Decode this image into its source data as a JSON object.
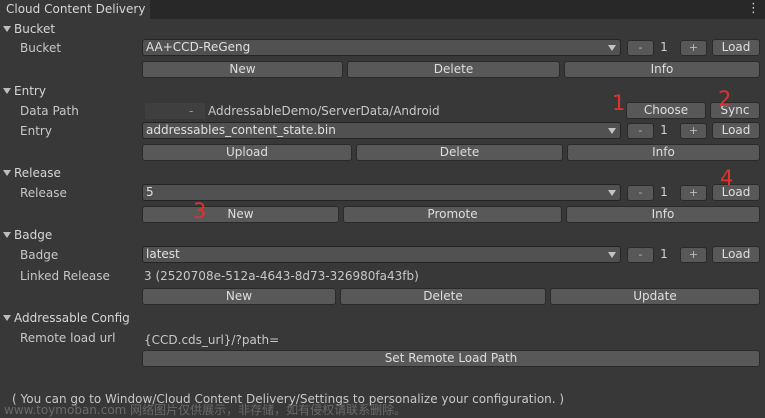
{
  "window": {
    "tab_title": "Cloud Content Delivery",
    "menu_icon": "kebab-menu-icon"
  },
  "bucket": {
    "section": "Bucket",
    "label": "Bucket",
    "selected": "AA+CCD-ReGeng",
    "count": "1",
    "minus": "-",
    "plus": "+",
    "load": "Load",
    "new": "New",
    "delete": "Delete",
    "info": "Info"
  },
  "entry": {
    "section": "Entry",
    "data_path_label": "Data Path",
    "data_path_tag": "-",
    "data_path_value": "AddressableDemo/ServerData/Android",
    "choose": "Choose",
    "sync": "Sync",
    "entry_label": "Entry",
    "selected": "addressables_content_state.bin",
    "count": "1",
    "minus": "-",
    "plus": "+",
    "load": "Load",
    "upload": "Upload",
    "delete": "Delete",
    "info": "Info"
  },
  "release": {
    "section": "Release",
    "label": "Release",
    "selected": "5",
    "count": "1",
    "minus": "-",
    "plus": "+",
    "load": "Load",
    "new": "New",
    "promote": "Promote",
    "info": "Info"
  },
  "badge": {
    "section": "Badge",
    "label": "Badge",
    "selected": "latest",
    "count": "1",
    "minus": "-",
    "plus": "+",
    "load": "Load",
    "linked_label": "Linked Release",
    "linked_value": "3 (2520708e-512a-4643-8d73-326980fa43fb)",
    "new": "New",
    "delete": "Delete",
    "update": "Update"
  },
  "addressable_config": {
    "section": "Addressable Config",
    "remote_label": "Remote load url",
    "remote_value": "{CCD.cds_url}/?path=",
    "set_path": "Set Remote Load Path"
  },
  "annotations": {
    "m1": "1",
    "m2": "2",
    "m3": "3",
    "m4": "4"
  },
  "footer": {
    "hint": "( You can go to Window/Cloud Content Delivery/Settings to personalize your configuration. )",
    "watermark": "www.toymoban.com 网络图片仅供展示，非存储，如有侵权请联系删除。"
  }
}
